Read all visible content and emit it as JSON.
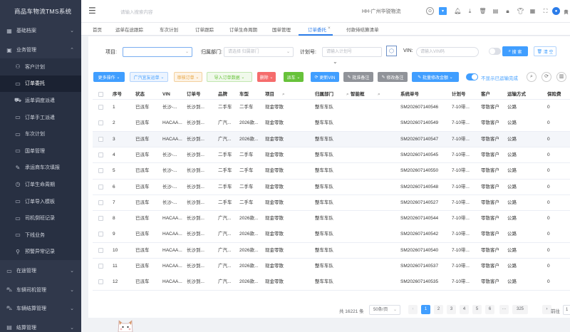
{
  "app_title": "商品车物流TMS系统",
  "sidebar": {
    "groups": [
      {
        "label": "基础档案",
        "icon": "grid-icon"
      },
      {
        "label": "业务管理",
        "icon": "briefcase-icon"
      }
    ],
    "items": [
      {
        "label": "客户计划",
        "icon": "user-icon"
      },
      {
        "label": "订单委托",
        "icon": "document-icon"
      },
      {
        "label": "运单调度派遣",
        "icon": "truck-icon"
      },
      {
        "label": "订单手工派遣",
        "icon": "document-icon"
      },
      {
        "label": "车次计划",
        "icon": "document-icon"
      },
      {
        "label": "国单管理",
        "icon": "document-icon"
      },
      {
        "label": "承运商车次填报",
        "icon": "edit-icon"
      },
      {
        "label": "订单生命周期",
        "icon": "clock-icon"
      },
      {
        "label": "订单导入模板",
        "icon": "document-icon"
      },
      {
        "label": "司机倒班记录",
        "icon": "document-icon"
      },
      {
        "label": "下线业务",
        "icon": "document-icon"
      },
      {
        "label": "预警异常记录",
        "icon": "pin-icon"
      }
    ],
    "bottom_groups": [
      {
        "label": "在途管理",
        "icon": "monitor-icon"
      },
      {
        "label": "车辆司机管理",
        "icon": "car-icon"
      },
      {
        "label": "车辆结算管理",
        "icon": "car-icon"
      },
      {
        "label": "结算管理",
        "icon": "wallet-icon"
      }
    ]
  },
  "header": {
    "search_placeholder": "请输入搜索内容",
    "company": "HH-广州华锐物流",
    "user_initial": "黄"
  },
  "tabs": [
    {
      "label": "首页"
    },
    {
      "label": "运单在途跟踪"
    },
    {
      "label": "车次计划"
    },
    {
      "label": "订单跟踪"
    },
    {
      "label": "订单生命周期"
    },
    {
      "label": "国单管理"
    },
    {
      "label": "订单委托",
      "closable": true
    },
    {
      "label": "付款待结算清单"
    }
  ],
  "filters": {
    "project_label": "项目:",
    "project_value": "",
    "dept_label": "归属部门:",
    "dept_placeholder": "请选择 归属部门",
    "plan_label": "计划号:",
    "plan_placeholder": "请输入计划号",
    "vin_label": "VIN:",
    "vin_placeholder": "请输入VIN码",
    "search_btn": "搜 索",
    "clear_btn": "清 空"
  },
  "toolbar": {
    "more": "更多操作",
    "guangqi": "广汽宜友运单",
    "audit": "审核订单",
    "import": "导入订单数据",
    "delete": "删除",
    "export": "派车",
    "update_vin": "更新VIN",
    "approve": "批准备注",
    "modify": "修改备注",
    "batch": "批量修改金额",
    "toggle_label": "不显示已运输完成"
  },
  "table": {
    "headers": [
      "序号",
      "状态",
      "VIN",
      "订单号",
      "品牌",
      "车型",
      "项目",
      "归属部门",
      "智能框",
      "系统单号",
      "计划号",
      "客户",
      "运输方式",
      "保险费"
    ],
    "rows": [
      [
        "1",
        "已派车",
        "长沙-...",
        "长沙到...",
        "二手车",
        "二手车",
        "现金零散",
        "整车车队",
        "",
        "SM202607140546",
        "7-10带...",
        "零散客户",
        "公路",
        "0"
      ],
      [
        "2",
        "已派车",
        "HACAA...",
        "长沙到...",
        "广汽...",
        "2026款...",
        "现金零散",
        "整车车队",
        "",
        "SM202607140549",
        "7-10带...",
        "零散客户",
        "公路",
        "0"
      ],
      [
        "3",
        "已派车",
        "HACAA...",
        "长沙到...",
        "广汽...",
        "2026款...",
        "现金零散",
        "整车车队",
        "",
        "SM202607140547",
        "7-10带...",
        "零散客户",
        "公路",
        "0"
      ],
      [
        "4",
        "已派车",
        "长沙-...",
        "长沙到...",
        "二手车",
        "二手车",
        "现金零散",
        "整车车队",
        "",
        "SM202607140545",
        "7-10带...",
        "零散客户",
        "公路",
        "0"
      ],
      [
        "5",
        "已派车",
        "长沙-...",
        "长沙到...",
        "二手车",
        "二手车",
        "现金零散",
        "整车车队",
        "",
        "SM202607140550",
        "7-10带...",
        "零散客户",
        "公路",
        "0"
      ],
      [
        "6",
        "已派车",
        "长沙-...",
        "长沙到...",
        "二手车",
        "二手车",
        "现金零散",
        "整车车队",
        "",
        "SM202607140548",
        "7-10带...",
        "零散客户",
        "公路",
        "0"
      ],
      [
        "7",
        "已派车",
        "长沙-...",
        "长沙到...",
        "二手车",
        "二手车",
        "现金零散",
        "整车车队",
        "",
        "SM202607140527",
        "7-10带...",
        "零散客户",
        "公路",
        "0"
      ],
      [
        "8",
        "已派车",
        "HACAA...",
        "长沙到...",
        "广汽...",
        "2026款...",
        "现金零散",
        "整车车队",
        "",
        "SM202607140544",
        "7-10带...",
        "零散客户",
        "公路",
        "0"
      ],
      [
        "9",
        "已派车",
        "HACAA...",
        "长沙到...",
        "广汽...",
        "2026款...",
        "现金零散",
        "整车车队",
        "",
        "SM202607140542",
        "7-10带...",
        "零散客户",
        "公路",
        "0"
      ],
      [
        "10",
        "已派车",
        "HACAA...",
        "长沙到...",
        "广汽...",
        "2026款...",
        "现金零散",
        "整车车队",
        "",
        "SM202607140540",
        "7-10带...",
        "零散客户",
        "公路",
        "0"
      ],
      [
        "11",
        "已派车",
        "HACAA...",
        "长沙到...",
        "广汽...",
        "2026款...",
        "现金零散",
        "整车车队",
        "",
        "SM202607140537",
        "7-10带...",
        "零散客户",
        "公路",
        "0"
      ],
      [
        "12",
        "已派车",
        "HACAA...",
        "长沙到...",
        "广汽...",
        "2026款...",
        "现金零散",
        "整车车队",
        "",
        "SM202607140535",
        "7-10带...",
        "零散客户",
        "公路",
        "0"
      ]
    ]
  },
  "pager": {
    "total": "共 16221 条",
    "page_size": "50条/页",
    "pages": [
      "1",
      "2",
      "3",
      "4",
      "5",
      "6",
      "···",
      "325"
    ],
    "goto_label": "前往",
    "goto_value": "1"
  },
  "colors": {
    "sidebar_bg": "#30384b",
    "accent": "#409eff"
  }
}
